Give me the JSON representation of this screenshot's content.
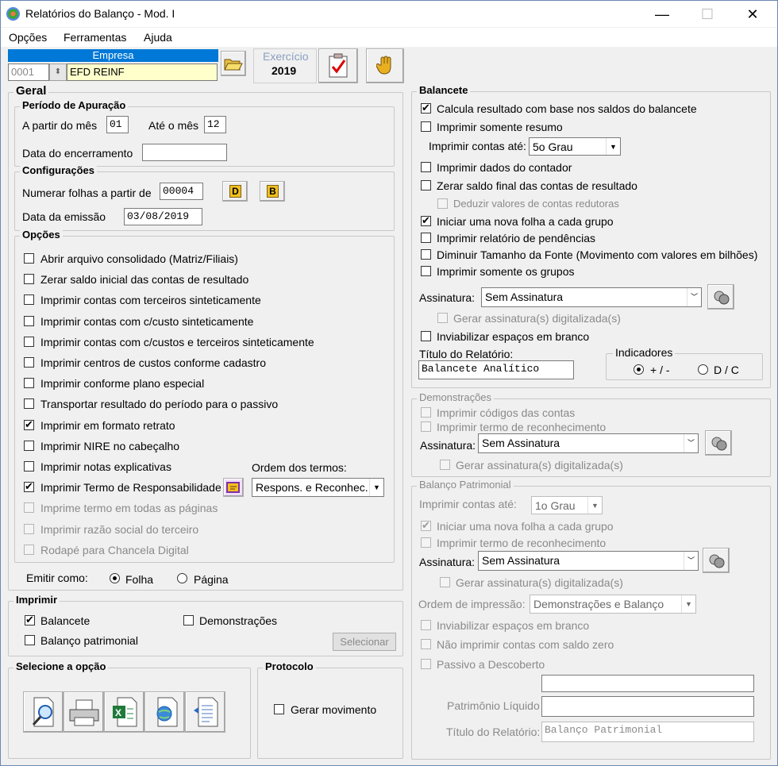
{
  "window": {
    "title": "Relatórios do Balanço - Mod. I",
    "minimize": "—",
    "maximize": "☐",
    "close": "✕"
  },
  "menu": {
    "opcoes": "Opções",
    "ferramentas": "Ferramentas",
    "ajuda": "Ajuda"
  },
  "empresa": {
    "label": "Empresa",
    "code": "0001",
    "name": "EFD REINF"
  },
  "exercicio": {
    "label": "Exercício",
    "value": "2019"
  },
  "geral": {
    "title": "Geral",
    "periodo": {
      "title": "Período de Apuração",
      "from_label": "A partir do mês",
      "from_value": "01",
      "to_label": "Até o mês",
      "to_value": "12",
      "closing_label": "Data do encerramento",
      "closing_value": ""
    },
    "config": {
      "title": "Configurações",
      "pages_label": "Numerar folhas a partir de",
      "pages_value": "00004",
      "d_button": "D",
      "b_button": "B",
      "emission_label": "Data da emissão",
      "emission_value": "03/08/2019"
    },
    "opcoes": {
      "title": "Opções",
      "items": [
        {
          "label": "Abrir arquivo consolidado (Matriz/Filiais)",
          "checked": false,
          "disabled": false
        },
        {
          "label": "Zerar saldo inicial das contas de resultado",
          "checked": false,
          "disabled": false
        },
        {
          "label": "Imprimir contas com terceiros sinteticamente",
          "checked": false,
          "disabled": false
        },
        {
          "label": "Imprimir contas com c/custo sinteticamente",
          "checked": false,
          "disabled": false
        },
        {
          "label": "Imprimir contas com c/custos e terceiros sinteticamente",
          "checked": false,
          "disabled": false
        },
        {
          "label": "Imprimir centros de custos conforme cadastro",
          "checked": false,
          "disabled": false
        },
        {
          "label": "Imprimir conforme plano especial",
          "checked": false,
          "disabled": false
        },
        {
          "label": "Transportar resultado do período para o passivo",
          "checked": false,
          "disabled": false
        },
        {
          "label": "Imprimir em formato retrato",
          "checked": true,
          "disabled": false
        },
        {
          "label": "Imprimir NIRE no cabeçalho",
          "checked": false,
          "disabled": false
        },
        {
          "label": "Imprimir notas explicativas",
          "checked": false,
          "disabled": false
        },
        {
          "label": "Imprimir Termo de Responsabilidade",
          "checked": true,
          "disabled": false
        },
        {
          "label": "Imprime termo em todas as páginas",
          "checked": false,
          "disabled": true
        },
        {
          "label": "Imprimir razão social do terceiro",
          "checked": false,
          "disabled": true
        },
        {
          "label": "Rodapé para Chancela Digital",
          "checked": false,
          "disabled": true
        }
      ],
      "ordem_label": "Ordem dos termos:",
      "ordem_value": "Respons. e Reconhec."
    },
    "emitir": {
      "label": "Emitir como:",
      "folha": "Folha",
      "pagina": "Página"
    }
  },
  "imprimir": {
    "title": "Imprimir",
    "balancete": "Balancete",
    "demonstracoes": "Demonstrações",
    "balanco": "Balanço patrimonial",
    "selecionar": "Selecionar"
  },
  "selecione": {
    "title": "Selecione a opção"
  },
  "protocolo": {
    "title": "Protocolo",
    "gerar": "Gerar movimento"
  },
  "balancete": {
    "title": "Balancete",
    "calcula": "Calcula resultado com base nos saldos do balancete",
    "resumo": "Imprimir somente resumo",
    "contas_ate_label": "Imprimir contas até:",
    "contas_ate_value": "5o Grau",
    "dados_contador": "Imprimir dados do contador",
    "zerar_saldo": "Zerar saldo final das contas de resultado",
    "deduzir": "Deduzir valores de contas redutoras",
    "nova_folha": "Iniciar uma nova folha a cada grupo",
    "pendencias": "Imprimir relatório de pendências",
    "diminuir": "Diminuir Tamanho da Fonte (Movimento com valores em bilhões)",
    "somente_grupos": "Imprimir somente os grupos",
    "assinatura_label": "Assinatura:",
    "assinatura_value": "Sem Assinatura",
    "gerar_assinatura": "Gerar assinatura(s) digitalizada(s)",
    "inviabilizar": "Inviabilizar espaços em branco",
    "titulo_label": "Título do Relatório:",
    "titulo_value": "Balancete Analítico",
    "indicadores": {
      "title": "Indicadores",
      "opt1": "+ / -",
      "opt2": "D / C"
    }
  },
  "demonstracoes": {
    "title": "Demonstrações",
    "codigos": "Imprimir códigos das contas",
    "termo": "Imprimir termo de reconhecimento",
    "assinatura_label": "Assinatura:",
    "assinatura_value": "Sem Assinatura",
    "gerar_assinatura": "Gerar assinatura(s) digitalizada(s)"
  },
  "balanco": {
    "title": "Balanço Patrimonial",
    "contas_ate_label": "Imprimir contas até:",
    "contas_ate_value": "1o Grau",
    "nova_folha": "Iniciar uma nova folha a cada grupo",
    "termo": "Imprimir termo de reconhecimento",
    "assinatura_label": "Assinatura:",
    "assinatura_value": "Sem Assinatura",
    "gerar_assinatura": "Gerar assinatura(s) digitalizada(s)",
    "ordem_label": "Ordem de impressão:",
    "ordem_value": "Demonstrações e Balanço",
    "inviabilizar": "Inviabilizar espaços em branco",
    "nao_imprimir": "Não imprimir contas com saldo zero",
    "passivo": "Passivo a Descoberto",
    "extra_value": "",
    "patrimonio_label": "Patrimônio Líquido",
    "patrimonio_value": "",
    "titulo_label": "Título do Relatório:",
    "titulo_value": "Balanço Patrimonial"
  }
}
